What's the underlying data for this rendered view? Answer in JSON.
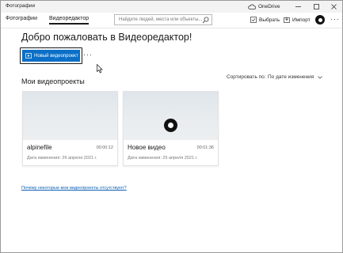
{
  "window": {
    "title": "Фотографии",
    "onedrive_label": "OneDrive"
  },
  "toolbar": {
    "tabs": [
      {
        "label": "Фотографии"
      },
      {
        "label": "Видеоредактор"
      }
    ],
    "search": {
      "placeholder": "Найдите людей, места или объекты..."
    },
    "select_label": "Выбрать",
    "import_label": "Импорт"
  },
  "main": {
    "welcome_title": "Добро пожаловать в Видеоредактор!",
    "new_project_label": "Новый видеопроект",
    "section_title": "Мои видеопроекты",
    "sort": {
      "label": "Сортировать по:",
      "value": "По дате изменения"
    },
    "projects": [
      {
        "name": "alpinefile",
        "duration": "00:00:12",
        "date": "Дата изменения: 26 апреля 2021 г."
      },
      {
        "name": "Новое видео",
        "duration": "00:01:36",
        "date": "Дата изменения: 25 апреля 2021 г."
      }
    ],
    "missing_link": "Почему некоторые мои видеопроекты отсутствуют?"
  },
  "colors": {
    "accent": "#0b6fc7",
    "link": "#0a5fb4"
  },
  "icons": [
    "onedrive-cloud-icon",
    "minimize-icon",
    "maximize-icon",
    "close-icon",
    "search-icon",
    "select-icon",
    "import-icon",
    "avatar",
    "more-icon",
    "video-project-icon",
    "chevron-down-icon",
    "cursor-icon"
  ]
}
